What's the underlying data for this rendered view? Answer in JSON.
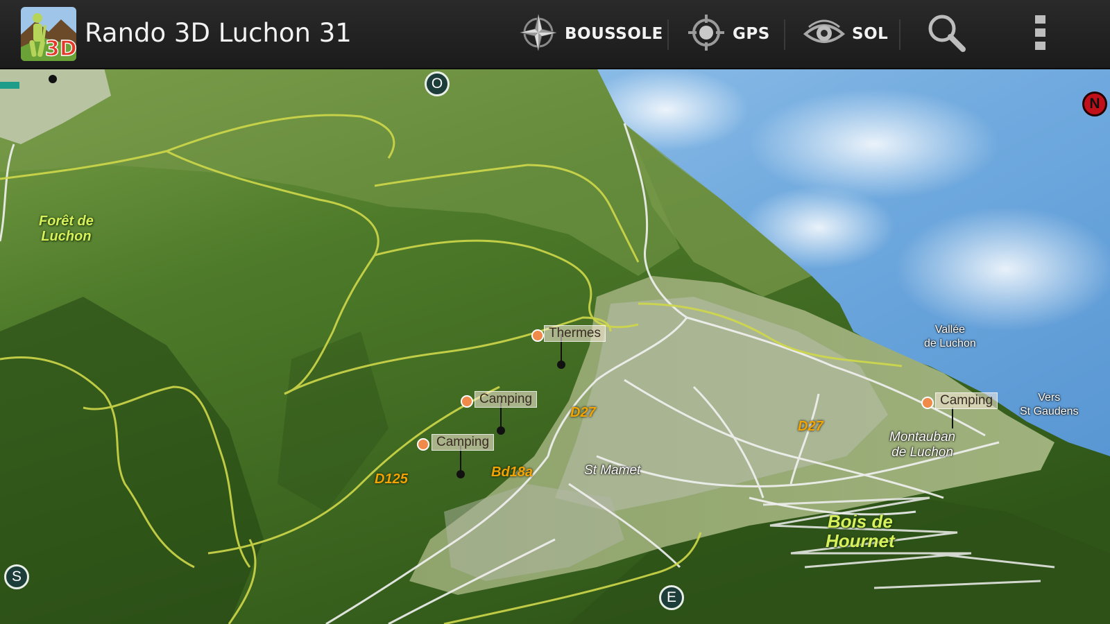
{
  "app": {
    "title": "Rando 3D Luchon 31",
    "icon_name": "app-logo-hiker-3d",
    "icon_text": "3D"
  },
  "toolbar": {
    "actions": [
      {
        "id": "compass",
        "label": "BOUSSOLE",
        "icon": "compass-icon"
      },
      {
        "id": "gps",
        "label": "GPS",
        "icon": "gps-target-icon"
      },
      {
        "id": "ground",
        "label": "SOL",
        "icon": "eye-icon"
      }
    ],
    "search_icon": "search-icon",
    "overflow_icon": "overflow-menu-icon"
  },
  "map": {
    "compass_markers": {
      "north": "N",
      "west": "O",
      "south": "S",
      "east": "E"
    },
    "pois": [
      {
        "label": "Thermes"
      },
      {
        "label": "Camping"
      },
      {
        "label": "Camping"
      },
      {
        "label": "Camping"
      }
    ],
    "roads": [
      "D27",
      "D27",
      "D125",
      "Bd18a"
    ],
    "places": {
      "st_mamet": "St Mamet",
      "vallee": [
        "Vallée",
        "de Luchon"
      ],
      "vers": [
        "Vers",
        "St Gaudens"
      ],
      "montauban": [
        "Montauban",
        "de Luchon"
      ]
    },
    "forests": {
      "foret_luchon": [
        "Forêt de",
        "Luchon"
      ],
      "bois_hournet": [
        "Bois de",
        "Hournet"
      ]
    }
  },
  "colors": {
    "actionbar": "#222222",
    "accent_orange": "#f08a4b",
    "road_label": "#f2a400",
    "trail": "#cfd84a",
    "sky": "#7fb4e0"
  }
}
